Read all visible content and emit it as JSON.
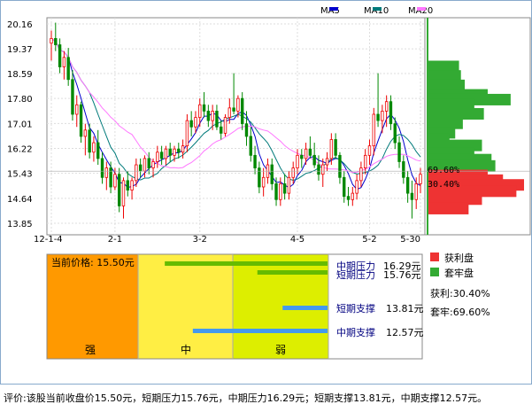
{
  "chart_data": [
    {
      "type": "candlestick",
      "legend": [
        {
          "label": "MA5",
          "color": "#0000cc"
        },
        {
          "label": "MA10",
          "color": "#007a7a"
        },
        {
          "label": "MA20",
          "color": "#ff77ff"
        }
      ],
      "y_ticks": [
        "20.16",
        "19.37",
        "18.59",
        "17.80",
        "17.01",
        "16.22",
        "15.43",
        "14.64",
        "13.85"
      ],
      "ylim": [
        13.85,
        20.16
      ],
      "x_ticks": [
        "12-1-4",
        "2-1",
        "3-2",
        "4-5",
        "5-2",
        "5-30"
      ],
      "up_color": "#ee0000",
      "down_color": "#008800",
      "candles": [
        [
          19.55,
          19.95,
          19.0,
          19.7
        ],
        [
          19.7,
          20.2,
          19.3,
          19.5
        ],
        [
          19.5,
          19.7,
          18.6,
          18.8
        ],
        [
          18.8,
          19.3,
          18.4,
          19.1
        ],
        [
          19.1,
          19.4,
          18.2,
          18.4
        ],
        [
          18.4,
          18.7,
          17.1,
          17.3
        ],
        [
          17.3,
          17.9,
          16.9,
          17.6
        ],
        [
          17.6,
          17.7,
          16.4,
          16.6
        ],
        [
          16.6,
          17.0,
          16.0,
          16.8
        ],
        [
          16.8,
          17.0,
          15.9,
          16.1
        ],
        [
          16.1,
          16.6,
          15.8,
          16.4
        ],
        [
          16.4,
          16.8,
          15.7,
          15.9
        ],
        [
          15.9,
          16.1,
          15.1,
          15.3
        ],
        [
          15.3,
          15.8,
          14.9,
          15.6
        ],
        [
          15.6,
          15.8,
          14.8,
          15.0
        ],
        [
          15.0,
          15.6,
          14.9,
          15.4
        ],
        [
          15.4,
          15.6,
          14.2,
          14.4
        ],
        [
          14.4,
          15.3,
          14.0,
          15.2
        ],
        [
          15.2,
          15.5,
          14.7,
          14.9
        ],
        [
          14.9,
          15.3,
          14.6,
          15.2
        ],
        [
          15.2,
          15.9,
          15.0,
          15.7
        ],
        [
          15.7,
          15.9,
          15.3,
          15.5
        ],
        [
          15.5,
          16.0,
          15.3,
          15.9
        ],
        [
          15.9,
          16.1,
          15.4,
          15.6
        ],
        [
          15.6,
          15.9,
          15.3,
          15.8
        ],
        [
          15.8,
          16.3,
          15.6,
          16.1
        ],
        [
          16.1,
          16.3,
          15.7,
          15.9
        ],
        [
          15.9,
          16.3,
          15.7,
          16.2
        ],
        [
          16.2,
          16.4,
          15.8,
          16.0
        ],
        [
          16.0,
          16.3,
          15.8,
          16.2
        ],
        [
          16.2,
          16.4,
          15.9,
          16.1
        ],
        [
          16.1,
          16.5,
          15.9,
          16.3
        ],
        [
          16.3,
          17.3,
          16.1,
          17.1
        ],
        [
          17.1,
          17.4,
          16.6,
          16.9
        ],
        [
          16.9,
          17.4,
          16.7,
          17.2
        ],
        [
          17.2,
          17.8,
          16.9,
          17.6
        ],
        [
          17.6,
          18.0,
          17.2,
          17.4
        ],
        [
          17.4,
          17.6,
          16.9,
          17.1
        ],
        [
          17.1,
          17.6,
          16.8,
          17.4
        ],
        [
          17.4,
          17.6,
          16.8,
          16.9
        ],
        [
          16.9,
          17.1,
          16.5,
          16.7
        ],
        [
          16.7,
          17.3,
          16.6,
          17.2
        ],
        [
          17.2,
          17.8,
          17.0,
          17.5
        ],
        [
          17.5,
          18.6,
          17.3,
          17.4
        ],
        [
          17.4,
          17.9,
          17.2,
          17.8
        ],
        [
          17.8,
          18.0,
          16.8,
          17.0
        ],
        [
          17.0,
          17.4,
          16.3,
          16.6
        ],
        [
          16.6,
          16.9,
          15.8,
          16.0
        ],
        [
          16.0,
          16.3,
          15.4,
          15.6
        ],
        [
          15.6,
          15.8,
          14.8,
          15.0
        ],
        [
          15.0,
          15.6,
          14.7,
          15.3
        ],
        [
          15.3,
          15.9,
          15.1,
          15.7
        ],
        [
          15.7,
          15.9,
          14.9,
          15.1
        ],
        [
          15.1,
          15.3,
          14.4,
          14.6
        ],
        [
          14.6,
          15.3,
          14.4,
          15.1
        ],
        [
          15.1,
          15.4,
          14.6,
          14.8
        ],
        [
          14.8,
          15.5,
          14.6,
          15.3
        ],
        [
          15.3,
          15.8,
          15.1,
          15.6
        ],
        [
          15.6,
          16.2,
          15.4,
          16.0
        ],
        [
          16.0,
          16.2,
          15.6,
          15.9
        ],
        [
          15.9,
          16.4,
          15.7,
          16.2
        ],
        [
          16.2,
          16.6,
          15.9,
          16.0
        ],
        [
          16.0,
          16.4,
          15.6,
          15.7
        ],
        [
          15.7,
          16.0,
          15.2,
          15.4
        ],
        [
          15.4,
          15.9,
          15.0,
          15.7
        ],
        [
          15.7,
          16.1,
          15.5,
          15.9
        ],
        [
          15.9,
          16.7,
          15.7,
          16.5
        ],
        [
          16.5,
          16.7,
          15.9,
          16.0
        ],
        [
          16.0,
          16.1,
          15.1,
          15.3
        ],
        [
          15.3,
          15.5,
          14.5,
          14.7
        ],
        [
          14.7,
          15.0,
          14.4,
          14.6
        ],
        [
          14.6,
          15.0,
          14.4,
          14.8
        ],
        [
          14.8,
          15.4,
          14.6,
          15.2
        ],
        [
          15.2,
          15.8,
          15.0,
          15.6
        ],
        [
          15.6,
          16.2,
          15.4,
          16.0
        ],
        [
          16.0,
          16.5,
          15.7,
          16.3
        ],
        [
          16.3,
          17.5,
          16.0,
          17.3
        ],
        [
          17.3,
          18.6,
          16.9,
          17.1
        ],
        [
          17.1,
          17.6,
          16.7,
          17.4
        ],
        [
          17.4,
          17.9,
          16.9,
          17.7
        ],
        [
          17.7,
          17.9,
          16.8,
          17.0
        ],
        [
          17.0,
          17.2,
          16.2,
          16.4
        ],
        [
          16.4,
          16.6,
          15.6,
          15.8
        ],
        [
          15.8,
          16.0,
          15.1,
          15.3
        ],
        [
          15.3,
          15.5,
          14.5,
          14.8
        ],
        [
          14.8,
          15.2,
          14.0,
          14.6
        ],
        [
          14.6,
          15.3,
          14.3,
          15.1
        ],
        [
          15.1,
          15.6,
          14.8,
          15.4
        ]
      ],
      "distribution_legend": [
        {
          "label": "获利盘",
          "color": "#ee3333"
        },
        {
          "label": "套牢盘",
          "color": "#33aa33"
        }
      ],
      "profit_label": "获利:30.40%",
      "trapped_label": "套牢:69.60%",
      "trapped_pct_tag": "69.60%",
      "profit_pct_tag": "30.40%",
      "current_price": 15.5,
      "distribution_bins": [
        [
          18.8,
          0.32,
          "trapped"
        ],
        [
          18.5,
          0.34,
          "trapped"
        ],
        [
          18.2,
          0.38,
          "trapped"
        ],
        [
          17.9,
          0.62,
          "trapped"
        ],
        [
          17.75,
          0.86,
          "trapped"
        ],
        [
          17.6,
          0.48,
          "trapped"
        ],
        [
          17.3,
          0.58,
          "trapped"
        ],
        [
          17.0,
          0.36,
          "trapped"
        ],
        [
          16.7,
          0.28,
          "trapped"
        ],
        [
          16.5,
          0.22,
          "trapped"
        ],
        [
          16.3,
          0.56,
          "trapped"
        ],
        [
          16.05,
          0.48,
          "trapped"
        ],
        [
          15.85,
          0.66,
          "trapped"
        ],
        [
          15.65,
          0.7,
          "trapped"
        ],
        [
          15.35,
          0.62,
          "profit"
        ],
        [
          15.2,
          0.78,
          "profit"
        ],
        [
          15.05,
          1.0,
          "profit"
        ],
        [
          14.85,
          0.92,
          "profit"
        ],
        [
          14.6,
          0.56,
          "profit"
        ],
        [
          14.3,
          0.42,
          "profit"
        ]
      ]
    },
    {
      "type": "horizontal_bar",
      "strength_zones": [
        {
          "label": "强",
          "color": "#ff9900"
        },
        {
          "label": "中",
          "color": "#ffee44"
        },
        {
          "label": "弱",
          "color": "#ddee00"
        }
      ],
      "current_price_label": "当前价格: 15.50元",
      "levels": [
        {
          "name": "中期压力",
          "value": "16.29元",
          "color": "#66bb00",
          "kind": "pressure",
          "from": 0.42
        },
        {
          "name": "短期压力",
          "value": "15.76元",
          "color": "#66bb00",
          "kind": "pressure",
          "from": 0.75
        },
        {
          "name": "短期支撑",
          "value": "13.81元",
          "color": "#4499ee",
          "kind": "support",
          "from": 0.84
        },
        {
          "name": "中期支撑",
          "value": "12.57元",
          "color": "#4499ee",
          "kind": "support",
          "from": 0.52
        }
      ]
    }
  ],
  "footer": {
    "text": "评价:该股当前收盘价15.50元，短期压力15.76元，中期压力16.29元；短期支撑13.81元，中期支撑12.57元。"
  }
}
